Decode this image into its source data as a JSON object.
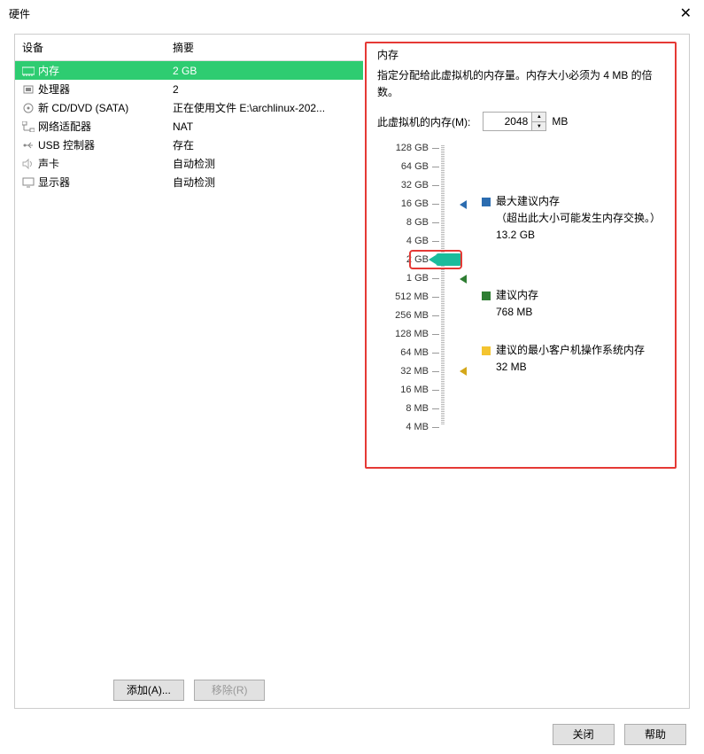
{
  "title": "硬件",
  "table": {
    "headers": {
      "device": "设备",
      "summary": "摘要"
    },
    "rows": [
      {
        "name": "内存",
        "summary": "2 GB",
        "selected": true
      },
      {
        "name": "处理器",
        "summary": "2"
      },
      {
        "name": "新 CD/DVD (SATA)",
        "summary": "正在使用文件 E:\\archlinux-202..."
      },
      {
        "name": "网络适配器",
        "summary": "NAT"
      },
      {
        "name": "USB 控制器",
        "summary": "存在"
      },
      {
        "name": "声卡",
        "summary": "自动检测"
      },
      {
        "name": "显示器",
        "summary": "自动检测"
      }
    ]
  },
  "buttons": {
    "add": "添加(A)...",
    "remove": "移除(R)",
    "close": "关闭",
    "help": "帮助"
  },
  "panel": {
    "title": "内存",
    "desc": "指定分配给此虚拟机的内存量。内存大小必须为 4 MB 的倍数。",
    "field_label": "此虚拟机的内存(M):",
    "value": "2048",
    "unit": "MB",
    "ticks": [
      "128 GB",
      "64 GB",
      "32 GB",
      "16 GB",
      "8 GB",
      "4 GB",
      "2 GB",
      "1 GB",
      "512 MB",
      "256 MB",
      "128 MB",
      "64 MB",
      "32 MB",
      "16 MB",
      "8 MB",
      "4 MB"
    ],
    "legend": {
      "max": {
        "title": "最大建议内存",
        "note": "（超出此大小可能发生内存交换。）",
        "value": "13.2 GB"
      },
      "rec": {
        "title": "建议内存",
        "value": "768 MB"
      },
      "min": {
        "title": "建议的最小客户机操作系统内存",
        "value": "32 MB"
      }
    }
  }
}
